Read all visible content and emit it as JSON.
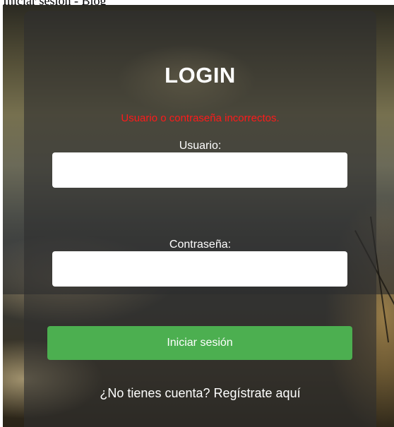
{
  "page": {
    "header_text": "Iniciar sesión - Blog"
  },
  "login": {
    "title": "LOGIN",
    "error_message": "Usuario o contraseña incorrectos.",
    "username_label": "Usuario:",
    "username_value": "",
    "password_label": "Contraseña:",
    "password_value": "",
    "submit_label": "Iniciar sesión",
    "register_link": "¿No tienes cuenta? Regístrate aquí"
  },
  "colors": {
    "error": "#ff1a1a",
    "submit_button": "#4caf50",
    "panel": "#2e2e2e"
  }
}
